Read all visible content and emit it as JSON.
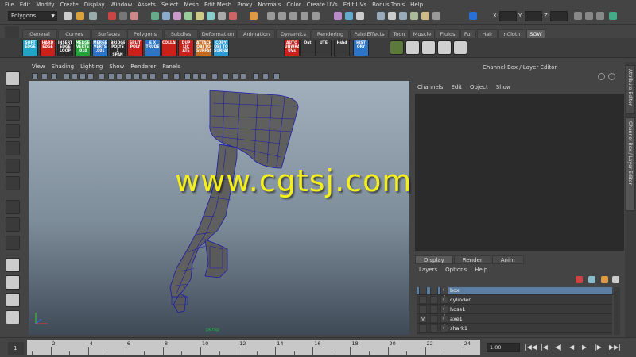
{
  "menubar": [
    "File",
    "Edit",
    "Modify",
    "Create",
    "Display",
    "Window",
    "Assets",
    "Select",
    "Mesh",
    "Edit Mesh",
    "Proxy",
    "Normals",
    "Color",
    "Create UVs",
    "Edit UVs",
    "Bonus Tools",
    "Help"
  ],
  "status": {
    "mode": "Polygons",
    "x_label": "X:",
    "y_label": "Y:",
    "z_label": "Z:"
  },
  "shelf_tabs": [
    "General",
    "Curves",
    "Surfaces",
    "Polygons",
    "Subdivs",
    "Deformation",
    "Animation",
    "Dynamics",
    "Rendering",
    "PaintEffects",
    "Toon",
    "Muscle",
    "Fluids",
    "Fur",
    "Hair",
    "nCloth",
    "SGW"
  ],
  "shelf_tab_active": "SGW",
  "shelf_buttons": [
    {
      "label": "SOFT EDGE",
      "color": "#1fa4c7"
    },
    {
      "label": "HARD EDGE",
      "color": "#c8211c"
    },
    {
      "label": "INSERT EDGE LOOP",
      "color": "#2b2b2b"
    },
    {
      "label": "MERGE VERTS .010",
      "color": "#23a23a"
    },
    {
      "label": "MERGE VERTS .001",
      "color": "#2b74c7"
    },
    {
      "label": "BRIDGE POLYS 1 SPAN",
      "color": "#2b2b2b"
    },
    {
      "label": "SPLIT POLY",
      "color": "#c8211c"
    },
    {
      "label": "E X TRUDE",
      "color": "#2b74c7"
    },
    {
      "label": "COLLAPSE",
      "color": "#c8211c"
    },
    {
      "label": "DUP LIC ATE",
      "color": "#c8211c"
    },
    {
      "label": "ATTACH OBJ TO SURFACE",
      "color": "#c86a1c"
    },
    {
      "label": "COPY OBJ TO SURFACE",
      "color": "#2b9bd6"
    },
    {
      "label": "AUTO UNWRAP UVs",
      "color": "#c8211c"
    },
    {
      "label": "Out",
      "color": "#3a3a3a"
    },
    {
      "label": "UTE",
      "color": "#3a3a3a"
    },
    {
      "label": "Hshd",
      "color": "#3a3a3a"
    },
    {
      "label": "HIST ORY",
      "color": "#2b74c7"
    }
  ],
  "viewport": {
    "menu": [
      "View",
      "Shading",
      "Lighting",
      "Show",
      "Renderer",
      "Panels"
    ],
    "camera": "persp",
    "watermark": "www.cgtsj.com"
  },
  "channel_box": {
    "title": "Channel Box / Layer Editor",
    "menu": [
      "Channels",
      "Edit",
      "Object",
      "Show"
    ]
  },
  "layer_editor": {
    "tabs": [
      "Display",
      "Render",
      "Anim"
    ],
    "active_tab": "Display",
    "menu": [
      "Layers",
      "Options",
      "Help"
    ],
    "layers": [
      {
        "name": "box",
        "vis": "",
        "selected": true
      },
      {
        "name": "cylinder",
        "vis": "",
        "selected": false
      },
      {
        "name": "hose1",
        "vis": "",
        "selected": false
      },
      {
        "name": "axe1",
        "vis": "V",
        "selected": false
      },
      {
        "name": "shark1",
        "vis": "",
        "selected": false
      }
    ]
  },
  "side_tabs": [
    "Attribute Editor",
    "Channel Box / Layer Editor"
  ],
  "timeline": {
    "start": "1",
    "ticks": [
      "2",
      "4",
      "6",
      "8",
      "10",
      "12",
      "14",
      "16",
      "18",
      "20",
      "22",
      "24"
    ],
    "current": "1.00"
  },
  "colors": {
    "selection": "#5d7ea3",
    "wireframe": "#1b1ba8",
    "mesh_gray": "#5f5f5f",
    "watermark": "#f4ef1c"
  }
}
